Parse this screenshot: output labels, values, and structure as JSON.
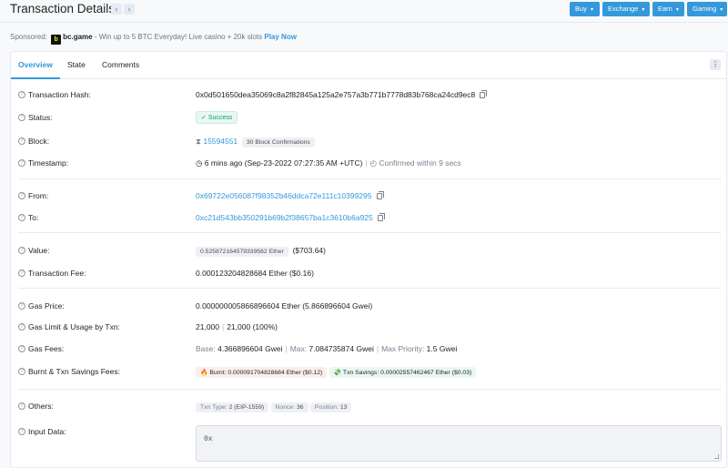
{
  "header": {
    "title": "Transaction Details",
    "prev_icon": "chevron-left-icon",
    "next_icon": "chevron-right-icon",
    "menus": [
      "Buy",
      "Exchange",
      "Earn",
      "Gaming"
    ]
  },
  "sponsor": {
    "prefix": "Sponsored:",
    "logo_text": "b",
    "brand": "bc.game",
    "text": " - Win up to 5 BTC Everyday! Live casino + 20k slots ",
    "cta": "Play Now"
  },
  "tabs": [
    "Overview",
    "State",
    "Comments"
  ],
  "more_icon": "⋮",
  "tx": {
    "hash_label": "Transaction Hash:",
    "hash": "0x0d501650dea35069c8a2f82845a125a2e757a3b771b7778d83b768ca24cd9ec8",
    "status_label": "Status:",
    "status": "Success",
    "block_label": "Block:",
    "block": "15594551",
    "confirmations": "30 Block Confirmations",
    "timestamp_label": "Timestamp:",
    "timestamp": "6 mins ago (Sep-23-2022 07:27:35 AM +UTC)",
    "confirmed": "Confirmed within 9 secs",
    "from_label": "From:",
    "from": "0x69722e056087f98352b46ddca72e111c10399295",
    "to_label": "To:",
    "to": "0xc21d543bb350291b69b2f38657ba1c3610b6a925",
    "value_label": "Value:",
    "value": "0.525872164579339562 Ether",
    "value_usd": "($703.64)",
    "fee_label": "Transaction Fee:",
    "fee": "0.000123204828684 Ether ($0.16)",
    "gas_price_label": "Gas Price:",
    "gas_price": "0.000000005866896604 Ether (5.866896604 Gwei)",
    "gas_limit_label": "Gas Limit & Usage by Txn:",
    "gas_limit": "21,000",
    "gas_usage": "21,000 (100%)",
    "gas_fees_label": "Gas Fees:",
    "gas_base_label": "Base: ",
    "gas_base": "4.366896604 Gwei",
    "gas_max_label": "Max: ",
    "gas_max": "7.084735874 Gwei",
    "gas_priority_label": "Max Priority: ",
    "gas_priority": "1.5 Gwei",
    "burnt_label": "Burnt & Txn Savings Fees:",
    "burnt": "🔥 Burnt: 0.000091704828684 Ether ($0.12)",
    "savings": "💸 Txn Savings: 0.00002557462467 Ether ($0.03)",
    "others_label": "Others:",
    "txn_type_label": "Txn Type: ",
    "txn_type": "2 (EIP-1559)",
    "nonce_label": "Nonce: ",
    "nonce": "36",
    "position_label": "Position: ",
    "position": "13",
    "input_label": "Input Data:",
    "input_value": "0x"
  }
}
